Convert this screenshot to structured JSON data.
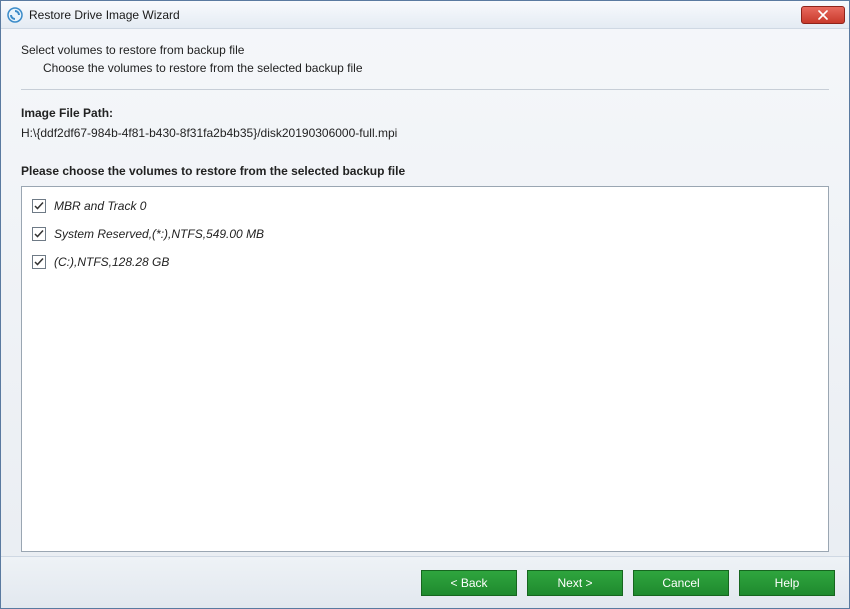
{
  "titlebar": {
    "title": "Restore Drive Image Wizard"
  },
  "intro": {
    "title": "Select volumes to restore from backup file",
    "subtitle": "Choose the volumes to restore from the selected backup file"
  },
  "imagePath": {
    "label": "Image File Path:",
    "value": "H:\\{ddf2df67-984b-4f81-b430-8f31fa2b4b35}/disk20190306000-full.mpi"
  },
  "chooseLabel": "Please choose the volumes to restore from the selected backup file",
  "volumes": [
    {
      "label": "MBR and Track 0",
      "checked": true
    },
    {
      "label": "System Reserved,(*:),NTFS,549.00 MB",
      "checked": true
    },
    {
      "label": "(C:),NTFS,128.28 GB",
      "checked": true
    }
  ],
  "footer": {
    "back": "< Back",
    "next": "Next >",
    "cancel": "Cancel",
    "help": "Help"
  }
}
